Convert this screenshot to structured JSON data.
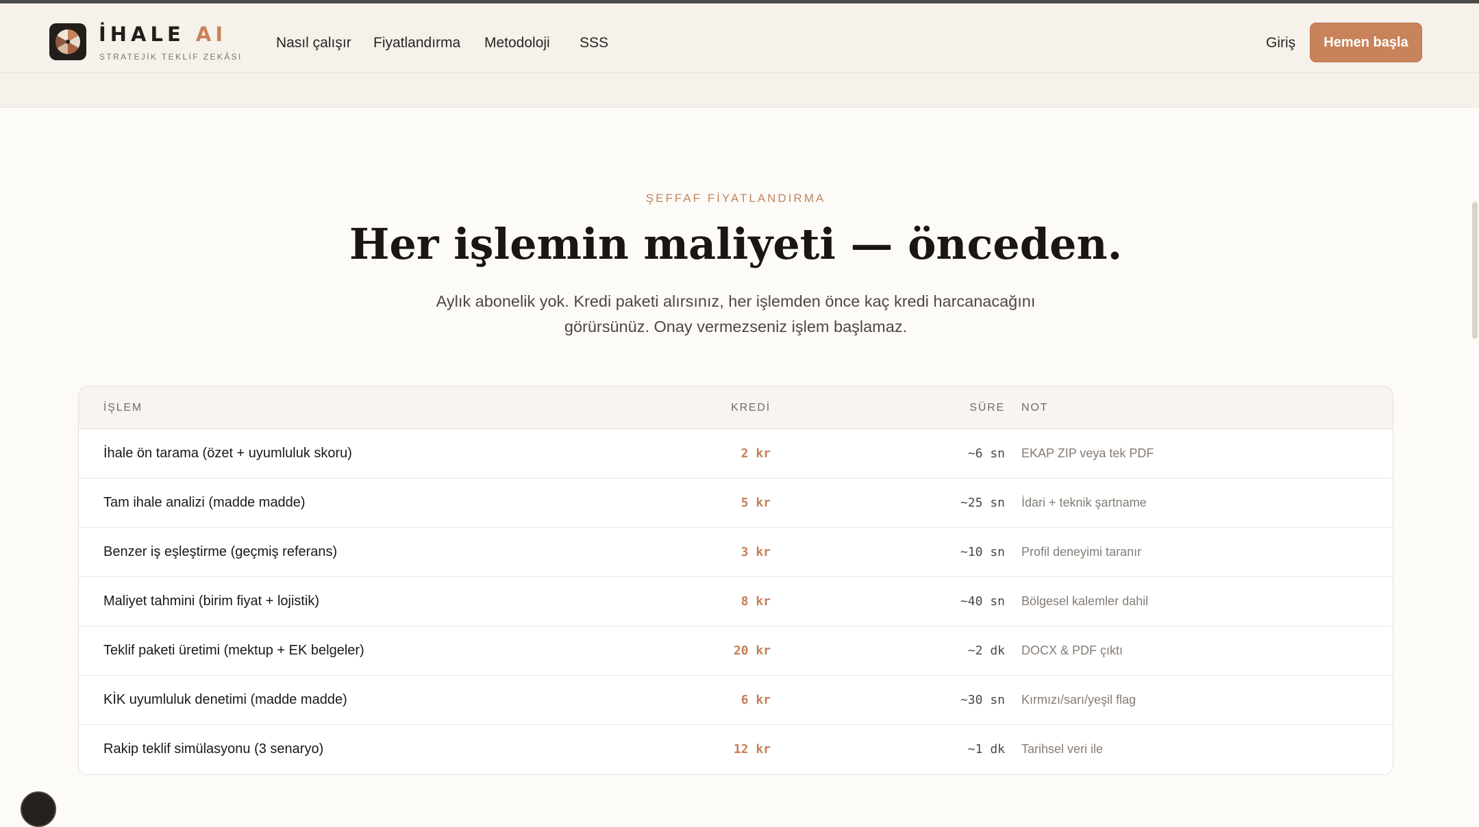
{
  "header": {
    "brand_main": "İHALE",
    "brand_accent": "AI",
    "tagline": "STRATEJİK TEKLİF ZEKÂSI",
    "nav": [
      "Nasıl çalışır",
      "Fiyatlandırma",
      "Metodoloji",
      "SSS"
    ],
    "login_label": "Giriş",
    "cta_label": "Hemen başla",
    "logo_icon": "fan-logo-icon"
  },
  "pricing": {
    "eyebrow": "ŞEFFAF FİYATLANDIRMA",
    "title": "Her işlemin maliyeti — önceden.",
    "subtitle": "Aylık abonelik yok. Kredi paketi alırsınız, her işlemden önce kaç kredi harcanacağını görürsünüz. Onay vermezseniz işlem başlamaz.",
    "columns": {
      "operation": "İŞLEM",
      "credit": "KREDİ",
      "duration": "SÜRE",
      "note": "NOT"
    },
    "rows": [
      {
        "operation": "İhale ön tarama (özet + uyumluluk skoru)",
        "credit": "2 kr",
        "duration": "~6 sn",
        "note": "EKAP ZIP veya tek PDF"
      },
      {
        "operation": "Tam ihale analizi (madde madde)",
        "credit": "5 kr",
        "duration": "~25 sn",
        "note": "İdari + teknik şartname"
      },
      {
        "operation": "Benzer iş eşleştirme (geçmiş referans)",
        "credit": "3 kr",
        "duration": "~10 sn",
        "note": "Profil deneyimi taranır"
      },
      {
        "operation": "Maliyet tahmini (birim fiyat + lojistik)",
        "credit": "8 kr",
        "duration": "~40 sn",
        "note": "Bölgesel kalemler dahil"
      },
      {
        "operation": "Teklif paketi üretimi (mektup + EK belgeler)",
        "credit": "20 kr",
        "duration": "~2 dk",
        "note": "DOCX & PDF çıktı"
      },
      {
        "operation": "KİK uyumluluk denetimi (madde madde)",
        "credit": "6 kr",
        "duration": "~30 sn",
        "note": "Kırmızı/sarı/yeşil flag"
      },
      {
        "operation": "Rakip teklif simülasyonu (3 senaryo)",
        "credit": "12 kr",
        "duration": "~1 dk",
        "note": "Tarihsel veri ile"
      }
    ]
  },
  "colors": {
    "accent": "#c8835b",
    "header_bg": "#f6f1eb",
    "page_bg": "#fdfbf8"
  }
}
